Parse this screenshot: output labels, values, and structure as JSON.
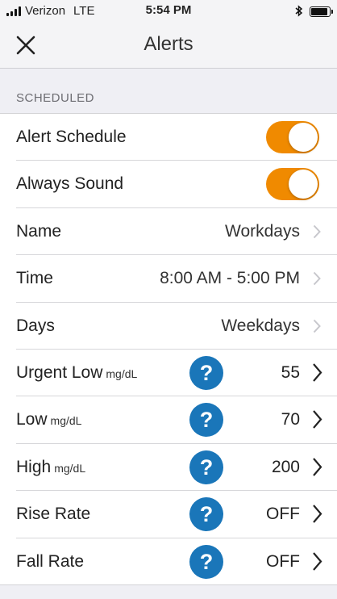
{
  "status_bar": {
    "carrier": "Verizon",
    "network": "LTE",
    "time": "5:54 PM",
    "signal_bars": 4,
    "battery_level": 0.9,
    "bluetooth_icon": "bluetooth-icon"
  },
  "nav": {
    "title": "Alerts",
    "close_icon": "close-icon"
  },
  "section": {
    "header": "SCHEDULED"
  },
  "colors": {
    "toggle_on": "#f08a00",
    "help_blue": "#1a76b9",
    "background": "#efeff4"
  },
  "rows": {
    "alert_schedule": {
      "label": "Alert Schedule",
      "toggle_on": true
    },
    "always_sound": {
      "label": "Always Sound",
      "toggle_on": true
    },
    "name": {
      "label": "Name",
      "value": "Workdays"
    },
    "time": {
      "label": "Time",
      "value": "8:00 AM - 5:00 PM"
    },
    "days": {
      "label": "Days",
      "value": "Weekdays"
    },
    "urgent_low": {
      "label": "Urgent Low",
      "unit": "mg/dL",
      "value": "55"
    },
    "low": {
      "label": "Low",
      "unit": "mg/dL",
      "value": "70"
    },
    "high": {
      "label": "High",
      "unit": "mg/dL",
      "value": "200"
    },
    "rise_rate": {
      "label": "Rise Rate",
      "value": "OFF"
    },
    "fall_rate": {
      "label": "Fall Rate",
      "value": "OFF"
    }
  },
  "help_label": "?"
}
